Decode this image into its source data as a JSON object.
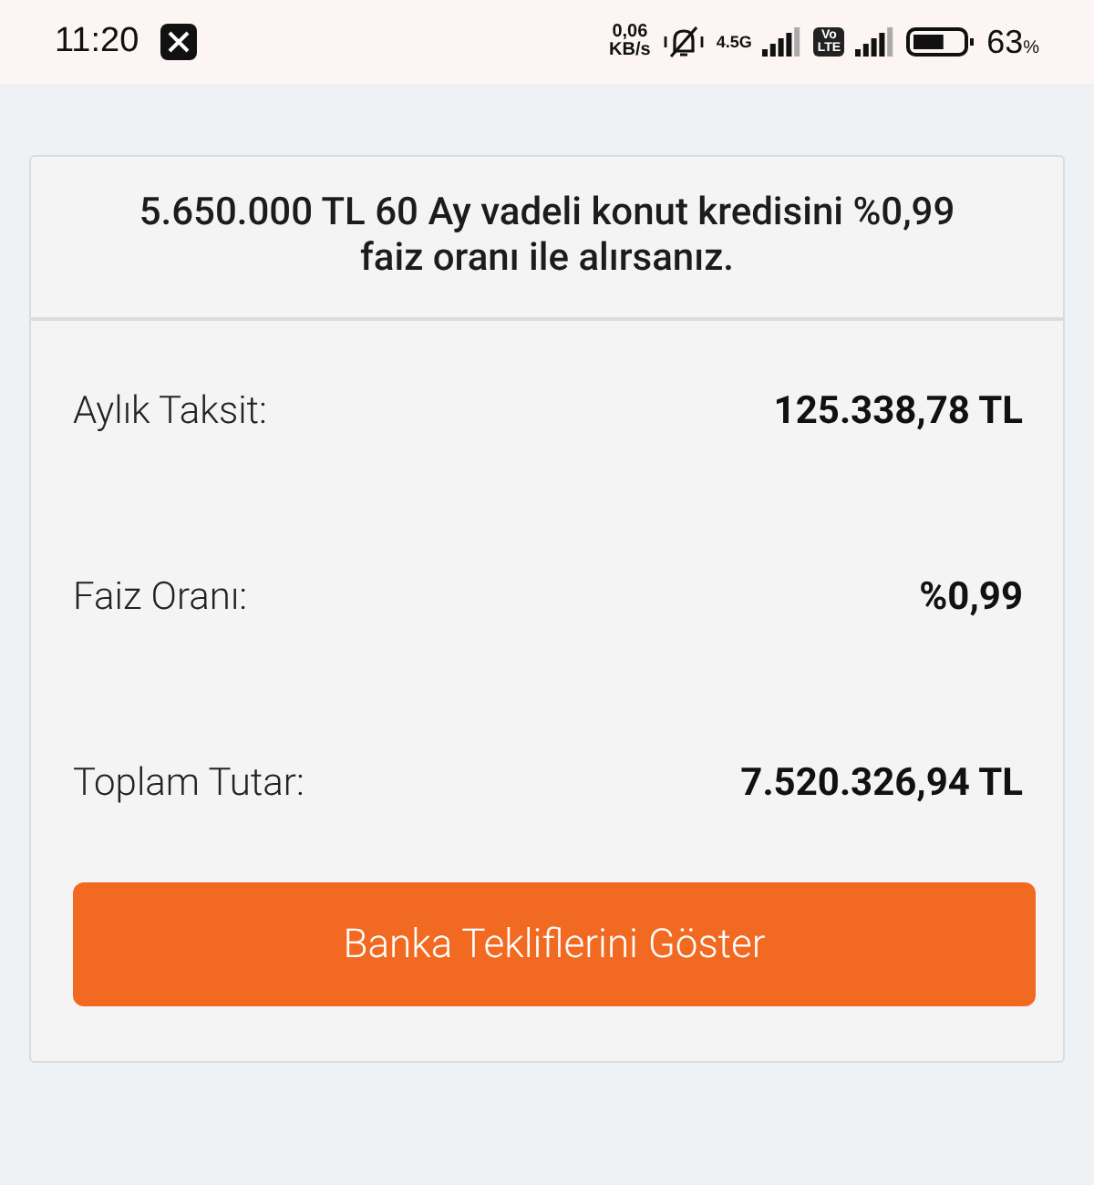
{
  "status_bar": {
    "time": "11:20",
    "speed_value": "0,06",
    "speed_unit": "KB/s",
    "network": "4.5G",
    "volte_top": "Vo",
    "volte_bottom": "LTE",
    "battery": "63",
    "battery_unit": "%"
  },
  "card": {
    "headline": "5.650.000 TL 60 Ay vadeli konut kredisini %0,99 faiz oranı ile alırsanız.",
    "rows": [
      {
        "label": "Aylık Taksit:",
        "value": "125.338,78 TL"
      },
      {
        "label": "Faiz Oranı:",
        "value": "%0,99"
      },
      {
        "label": "Toplam Tutar:",
        "value": "7.520.326,94 TL"
      }
    ],
    "button": "Banka Tekliflerini Göster"
  }
}
